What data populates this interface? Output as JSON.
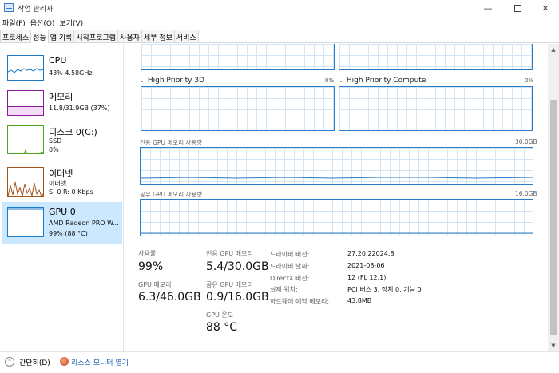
{
  "window": {
    "title": "작업 관리자",
    "minimize_glyph": "—",
    "close_glyph": "✕"
  },
  "menu": [
    "파일(F)",
    "옵션(O)",
    "보기(V)"
  ],
  "tabs": [
    {
      "label": "프로세스",
      "active": false
    },
    {
      "label": "성능",
      "active": true
    },
    {
      "label": "앱 기록",
      "active": false
    },
    {
      "label": "시작프로그램",
      "active": false
    },
    {
      "label": "사용자",
      "active": false
    },
    {
      "label": "세부 정보",
      "active": false
    },
    {
      "label": "서비스",
      "active": false
    }
  ],
  "sidebar": {
    "items": [
      {
        "name": "CPU",
        "line1": "43% 4.58GHz",
        "line2": "",
        "color": "#1a7ac7"
      },
      {
        "name": "메모리",
        "line1": "11.8/31.9GB (37%)",
        "line2": "",
        "color": "#8b1a9e"
      },
      {
        "name": "디스크 0(C:)",
        "line1": "SSD",
        "line2": "0%",
        "color": "#4ca81e"
      },
      {
        "name": "이더넷",
        "line1": "이더넷",
        "line2": "S: 0 R: 0 Kbps",
        "color": "#a3531c"
      },
      {
        "name": "GPU 0",
        "line1": "AMD Radeon PRO W...",
        "line2": "99% (88 °C)",
        "color": "#1a7ac7"
      }
    ]
  },
  "graphs": {
    "hp3d_label": "High Priority 3D",
    "hp3d_pct": "0%",
    "hpcompute_label": "High Priority Compute",
    "hpcompute_pct": "0%",
    "dedicated_label": "전용 GPU 메모리 사용량",
    "dedicated_max": "30.0GB",
    "shared_label": "공유 GPU 메모리 사용량",
    "shared_max": "16.0GB",
    "line_color": "#2a7cc7"
  },
  "stats": {
    "utilization_label": "사용률",
    "utilization_value": "99%",
    "gpu_mem_label": "GPU 메모리",
    "gpu_mem_value": "6.3/46.0GB",
    "dedicated_label": "전용 GPU 메모리",
    "dedicated_value": "5.4/30.0GB",
    "shared_label": "공유 GPU 메모리",
    "shared_value": "0.9/16.0GB",
    "temp_label": "GPU 온도",
    "temp_value": "88 °C"
  },
  "info": [
    {
      "key": "드라이버 버전:",
      "value": "27.20.22024.8"
    },
    {
      "key": "드라이버 날짜:",
      "value": "2021-08-06"
    },
    {
      "key": "DirectX 버전:",
      "value": "12 (FL 12.1)"
    },
    {
      "key": "실제 위치:",
      "value": "PCI 버스 3, 장치 0, 기능 0"
    },
    {
      "key": "하드웨어 예약 메모리:",
      "value": "43.8MB"
    }
  ],
  "footer": {
    "brief_label": "간단히(D)",
    "monitor_link": "리소스 모니터 열기"
  }
}
